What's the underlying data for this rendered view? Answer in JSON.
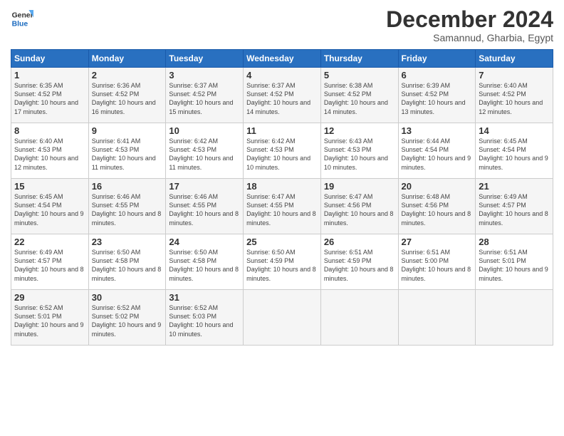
{
  "header": {
    "logo_line1": "General",
    "logo_line2": "Blue",
    "month_title": "December 2024",
    "subtitle": "Samannud, Gharbia, Egypt"
  },
  "days_of_week": [
    "Sunday",
    "Monday",
    "Tuesday",
    "Wednesday",
    "Thursday",
    "Friday",
    "Saturday"
  ],
  "weeks": [
    [
      {
        "day": 1,
        "sunrise": "6:35 AM",
        "sunset": "4:52 PM",
        "daylight": "10 hours and 17 minutes."
      },
      {
        "day": 2,
        "sunrise": "6:36 AM",
        "sunset": "4:52 PM",
        "daylight": "10 hours and 16 minutes."
      },
      {
        "day": 3,
        "sunrise": "6:37 AM",
        "sunset": "4:52 PM",
        "daylight": "10 hours and 15 minutes."
      },
      {
        "day": 4,
        "sunrise": "6:37 AM",
        "sunset": "4:52 PM",
        "daylight": "10 hours and 14 minutes."
      },
      {
        "day": 5,
        "sunrise": "6:38 AM",
        "sunset": "4:52 PM",
        "daylight": "10 hours and 14 minutes."
      },
      {
        "day": 6,
        "sunrise": "6:39 AM",
        "sunset": "4:52 PM",
        "daylight": "10 hours and 13 minutes."
      },
      {
        "day": 7,
        "sunrise": "6:40 AM",
        "sunset": "4:52 PM",
        "daylight": "10 hours and 12 minutes."
      }
    ],
    [
      {
        "day": 8,
        "sunrise": "6:40 AM",
        "sunset": "4:53 PM",
        "daylight": "10 hours and 12 minutes."
      },
      {
        "day": 9,
        "sunrise": "6:41 AM",
        "sunset": "4:53 PM",
        "daylight": "10 hours and 11 minutes."
      },
      {
        "day": 10,
        "sunrise": "6:42 AM",
        "sunset": "4:53 PM",
        "daylight": "10 hours and 11 minutes."
      },
      {
        "day": 11,
        "sunrise": "6:42 AM",
        "sunset": "4:53 PM",
        "daylight": "10 hours and 10 minutes."
      },
      {
        "day": 12,
        "sunrise": "6:43 AM",
        "sunset": "4:53 PM",
        "daylight": "10 hours and 10 minutes."
      },
      {
        "day": 13,
        "sunrise": "6:44 AM",
        "sunset": "4:54 PM",
        "daylight": "10 hours and 9 minutes."
      },
      {
        "day": 14,
        "sunrise": "6:45 AM",
        "sunset": "4:54 PM",
        "daylight": "10 hours and 9 minutes."
      }
    ],
    [
      {
        "day": 15,
        "sunrise": "6:45 AM",
        "sunset": "4:54 PM",
        "daylight": "10 hours and 9 minutes."
      },
      {
        "day": 16,
        "sunrise": "6:46 AM",
        "sunset": "4:55 PM",
        "daylight": "10 hours and 8 minutes."
      },
      {
        "day": 17,
        "sunrise": "6:46 AM",
        "sunset": "4:55 PM",
        "daylight": "10 hours and 8 minutes."
      },
      {
        "day": 18,
        "sunrise": "6:47 AM",
        "sunset": "4:55 PM",
        "daylight": "10 hours and 8 minutes."
      },
      {
        "day": 19,
        "sunrise": "6:47 AM",
        "sunset": "4:56 PM",
        "daylight": "10 hours and 8 minutes."
      },
      {
        "day": 20,
        "sunrise": "6:48 AM",
        "sunset": "4:56 PM",
        "daylight": "10 hours and 8 minutes."
      },
      {
        "day": 21,
        "sunrise": "6:49 AM",
        "sunset": "4:57 PM",
        "daylight": "10 hours and 8 minutes."
      }
    ],
    [
      {
        "day": 22,
        "sunrise": "6:49 AM",
        "sunset": "4:57 PM",
        "daylight": "10 hours and 8 minutes."
      },
      {
        "day": 23,
        "sunrise": "6:50 AM",
        "sunset": "4:58 PM",
        "daylight": "10 hours and 8 minutes."
      },
      {
        "day": 24,
        "sunrise": "6:50 AM",
        "sunset": "4:58 PM",
        "daylight": "10 hours and 8 minutes."
      },
      {
        "day": 25,
        "sunrise": "6:50 AM",
        "sunset": "4:59 PM",
        "daylight": "10 hours and 8 minutes."
      },
      {
        "day": 26,
        "sunrise": "6:51 AM",
        "sunset": "4:59 PM",
        "daylight": "10 hours and 8 minutes."
      },
      {
        "day": 27,
        "sunrise": "6:51 AM",
        "sunset": "5:00 PM",
        "daylight": "10 hours and 8 minutes."
      },
      {
        "day": 28,
        "sunrise": "6:51 AM",
        "sunset": "5:01 PM",
        "daylight": "10 hours and 9 minutes."
      }
    ],
    [
      {
        "day": 29,
        "sunrise": "6:52 AM",
        "sunset": "5:01 PM",
        "daylight": "10 hours and 9 minutes."
      },
      {
        "day": 30,
        "sunrise": "6:52 AM",
        "sunset": "5:02 PM",
        "daylight": "10 hours and 9 minutes."
      },
      {
        "day": 31,
        "sunrise": "6:52 AM",
        "sunset": "5:03 PM",
        "daylight": "10 hours and 10 minutes."
      },
      null,
      null,
      null,
      null
    ]
  ]
}
